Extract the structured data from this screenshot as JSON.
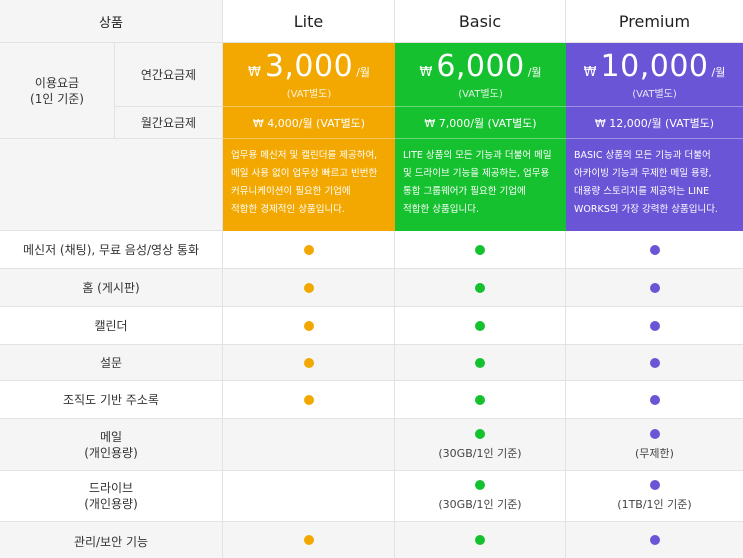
{
  "header": {
    "product_label": "상품",
    "plans": [
      "Lite",
      "Basic",
      "Premium"
    ]
  },
  "pricing": {
    "group_label": "이용요금",
    "group_sublabel": "(1인 기준)",
    "annual_label": "연간요금제",
    "monthly_label": "월간요금제",
    "currency": "₩",
    "per_month": "/월",
    "vat": "(VAT별도)",
    "annual": [
      "3,000",
      "6,000",
      "10,000"
    ],
    "monthly": [
      "₩ 4,000/월 (VAT별도)",
      "₩ 7,000/월 (VAT별도)",
      "₩ 12,000/월 (VAT별도)"
    ]
  },
  "descriptions": [
    [
      "업무용 메신저 및 캘린더를 제공하여,",
      "메일 사용 없이 업무상 빠르고 빈번한",
      "커뮤니케이션이 필요한 기업에",
      "적합한 경제적인 상품입니다."
    ],
    [
      "LITE 상품의 모든 기능과 더불어 메일",
      "및 드라이브 기능을 제공하는, 업무용",
      "통합 그룹웨어가 필요한 기업에",
      "적합한 상품입니다."
    ],
    [
      "BASIC 상품의 모든 기능과 더불어",
      "아카이빙 기능과 무제한 메일 용량,",
      "대용량 스토리지를 제공하는 LINE",
      "WORKS의 가장 강력한 상품입니다."
    ]
  ],
  "features": [
    {
      "label": "메신저 (채팅), 무료 음성/영상  통화",
      "sublabel": "",
      "lite": true,
      "basic": true,
      "premium": true,
      "basic_note": "",
      "premium_note": ""
    },
    {
      "label": "홈 (게시판)",
      "sublabel": "",
      "lite": true,
      "basic": true,
      "premium": true,
      "basic_note": "",
      "premium_note": ""
    },
    {
      "label": "캘린더",
      "sublabel": "",
      "lite": true,
      "basic": true,
      "premium": true,
      "basic_note": "",
      "premium_note": ""
    },
    {
      "label": "설문",
      "sublabel": "",
      "lite": true,
      "basic": true,
      "premium": true,
      "basic_note": "",
      "premium_note": ""
    },
    {
      "label": "조직도 기반 주소록",
      "sublabel": "",
      "lite": true,
      "basic": true,
      "premium": true,
      "basic_note": "",
      "premium_note": ""
    },
    {
      "label": "메일",
      "sublabel": "(개인용량)",
      "lite": false,
      "basic": true,
      "premium": true,
      "basic_note": "(30GB/1인 기준)",
      "premium_note": "(무제한)"
    },
    {
      "label": "드라이브",
      "sublabel": "(개인용량)",
      "lite": false,
      "basic": true,
      "premium": true,
      "basic_note": "(30GB/1인 기준)",
      "premium_note": "(1TB/1인 기준)"
    },
    {
      "label": "관리/보안 기능",
      "sublabel": "",
      "lite": true,
      "basic": true,
      "premium": true,
      "basic_note": "",
      "premium_note": ""
    }
  ],
  "colors": {
    "lite": "#f2a800",
    "basic": "#16c12f",
    "premium": "#6a55d6"
  }
}
